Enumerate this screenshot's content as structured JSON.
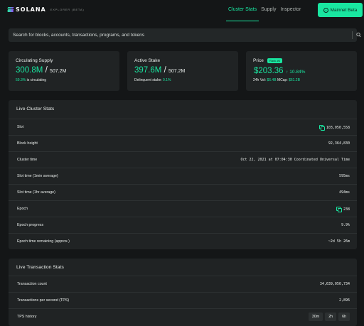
{
  "header": {
    "logo_text": "SOLANA",
    "logo_sub": "EXPLORER (BETA)",
    "nav": [
      {
        "label": "Cluster Stats",
        "active": true
      },
      {
        "label": "Supply",
        "active": false
      },
      {
        "label": "Inspector",
        "active": false
      }
    ],
    "cluster_button": "Mainnet Beta"
  },
  "search": {
    "placeholder": "Search for blocks, accounts, transactions, programs, and tokens"
  },
  "supply_card": {
    "label": "Circulating Supply",
    "value": "300.8M",
    "total": "507.2M",
    "note_pct": "59.3%",
    "note_text": "is circulating"
  },
  "stake_card": {
    "label": "Active Stake",
    "value": "397.6M",
    "total": "507.2M",
    "note_text": "Delinquent stake:",
    "note_pct": "0.1%"
  },
  "price_card": {
    "label": "Price",
    "rank": "Rank #6",
    "value": "$203.36",
    "change": "↑ 10.84%",
    "vol_label": "24h Vol:",
    "vol_value": "$6.4B",
    "mcap_label": "MCap:",
    "mcap_value": "$61.2B"
  },
  "cluster_stats": {
    "title": "Live Cluster Stats",
    "rows": [
      {
        "label": "Slot",
        "value": "103,050,558",
        "link": true
      },
      {
        "label": "Block height",
        "value": "92,364,830",
        "link": false
      },
      {
        "label": "Cluster time",
        "value": "Oct 22, 2021 at 07:04:30 Coordinated Universal Time",
        "link": false
      },
      {
        "label": "Slot time (1min average)",
        "value": "595ms",
        "link": false
      },
      {
        "label": "Slot time (1hr average)",
        "value": "494ms",
        "link": false
      },
      {
        "label": "Epoch",
        "value": "238",
        "link": true
      },
      {
        "label": "Epoch progress",
        "value": "9.9%",
        "link": false
      },
      {
        "label": "Epoch time remaining (approx.)",
        "value": "~2d 5h 26m",
        "link": false
      }
    ]
  },
  "transaction_stats": {
    "title": "Live Transaction Stats",
    "rows": [
      {
        "label": "Transaction count",
        "value": "34,639,050,734"
      },
      {
        "label": "Transactions per second (TPS)",
        "value": "2,896"
      }
    ],
    "tps_history_label": "TPS history",
    "tps_buttons": [
      "30m",
      "2h",
      "6h"
    ]
  },
  "colors": {
    "accent": "#19e6a0",
    "background": "#141617",
    "card": "#202324"
  }
}
